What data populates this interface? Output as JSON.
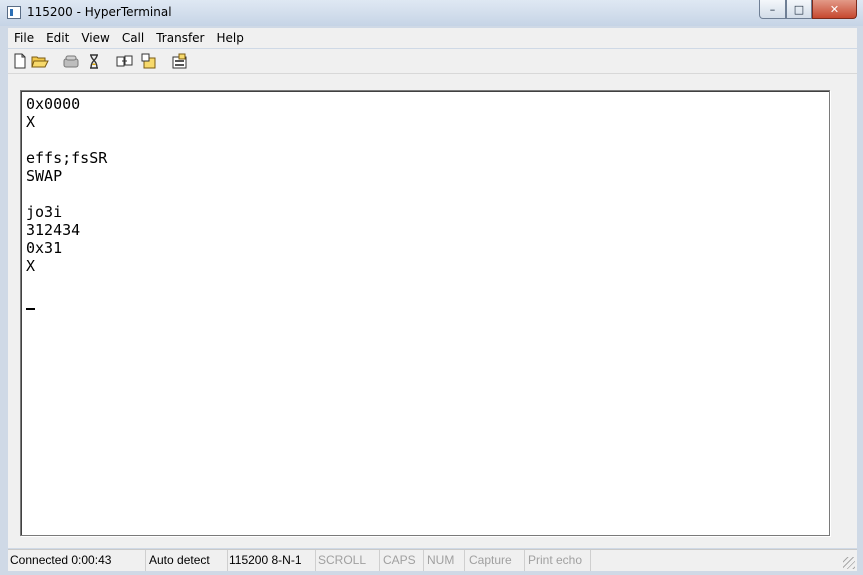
{
  "window": {
    "title": "115200 - HyperTerminal",
    "controls": {
      "minimize": "–",
      "maximize": "□",
      "close": "✕"
    }
  },
  "menu": [
    "File",
    "Edit",
    "View",
    "Call",
    "Transfer",
    "Help"
  ],
  "toolbar": {
    "buttons": [
      {
        "name": "new-connection-icon"
      },
      {
        "name": "open-icon"
      },
      {
        "name": "connect-icon"
      },
      {
        "name": "disconnect-icon"
      },
      {
        "name": "send-icon"
      },
      {
        "name": "receive-icon"
      },
      {
        "name": "properties-icon"
      }
    ]
  },
  "terminal": {
    "lines": [
      "0x0000",
      "X",
      "",
      "effs;fsSR",
      "SWAP",
      "",
      "jo3i",
      "312434",
      "0x31",
      "X",
      "",
      ""
    ]
  },
  "status": {
    "connected": "Connected 0:00:43",
    "detect": "Auto detect",
    "settings": "115200 8-N-1",
    "scroll": "SCROLL",
    "caps": "CAPS",
    "num": "NUM",
    "capture": "Capture",
    "print_echo": "Print echo"
  }
}
